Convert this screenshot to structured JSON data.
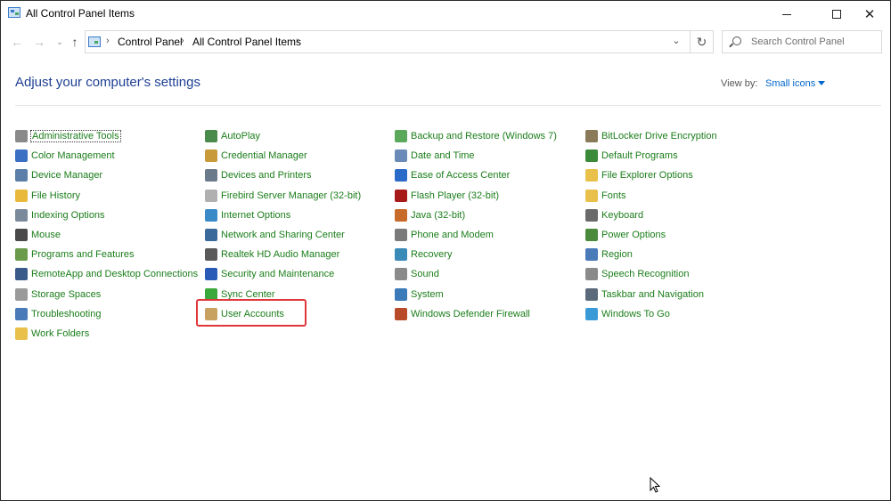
{
  "window": {
    "title": "All Control Panel Items"
  },
  "titlebar": {
    "minimize": "—",
    "close": "✕"
  },
  "nav": {
    "back": "←",
    "forward": "→",
    "recent": "⌄",
    "up": "↑",
    "separator": "›",
    "breadcrumbs": [
      "Control Panel",
      "All Control Panel Items"
    ],
    "dropdown": "⌄",
    "refresh": "↻"
  },
  "search": {
    "placeholder": "Search Control Panel"
  },
  "header": {
    "title": "Adjust your computer's settings",
    "view_by_label": "View by:",
    "view_by_value": "Small icons"
  },
  "colors": {
    "link": "#1a7d1a",
    "title": "#1e3f93",
    "accent": "#0066cc",
    "highlight": "#e0363a"
  },
  "columns": [
    [
      {
        "label": "Administrative Tools",
        "icon": "admin-tools-icon",
        "color": "#8a8a8a",
        "focused": true
      },
      {
        "label": "Color Management",
        "icon": "color-management-icon",
        "color": "#3a6fc4"
      },
      {
        "label": "Device Manager",
        "icon": "device-manager-icon",
        "color": "#5b7fa8"
      },
      {
        "label": "File History",
        "icon": "file-history-icon",
        "color": "#e8b93a"
      },
      {
        "label": "Indexing Options",
        "icon": "indexing-options-icon",
        "color": "#7a8a9a"
      },
      {
        "label": "Mouse",
        "icon": "mouse-icon",
        "color": "#4a4a4a"
      },
      {
        "label": "Programs and Features",
        "icon": "programs-features-icon",
        "color": "#6a9a4a"
      },
      {
        "label": "RemoteApp and Desktop Connections",
        "icon": "remoteapp-icon",
        "color": "#3a5a8a"
      },
      {
        "label": "Storage Spaces",
        "icon": "storage-spaces-icon",
        "color": "#9a9a9a"
      },
      {
        "label": "Troubleshooting",
        "icon": "troubleshooting-icon",
        "color": "#4a7ab8"
      },
      {
        "label": "Work Folders",
        "icon": "work-folders-icon",
        "color": "#e8c04a"
      }
    ],
    [
      {
        "label": "AutoPlay",
        "icon": "autoplay-icon",
        "color": "#4a8a4a"
      },
      {
        "label": "Credential Manager",
        "icon": "credential-manager-icon",
        "color": "#c89a3a"
      },
      {
        "label": "Devices and Printers",
        "icon": "devices-printers-icon",
        "color": "#6a7a8a"
      },
      {
        "label": "Firebird Server Manager (32-bit)",
        "icon": "firebird-icon",
        "color": "#b0b0b0"
      },
      {
        "label": "Internet Options",
        "icon": "internet-options-icon",
        "color": "#3a8ac8"
      },
      {
        "label": "Network and Sharing Center",
        "icon": "network-sharing-icon",
        "color": "#3a6a9a"
      },
      {
        "label": "Realtek HD Audio Manager",
        "icon": "realtek-audio-icon",
        "color": "#5a5a5a"
      },
      {
        "label": "Security and Maintenance",
        "icon": "security-maintenance-icon",
        "color": "#2a5ab8"
      },
      {
        "label": "Sync Center",
        "icon": "sync-center-icon",
        "color": "#3aa83a"
      },
      {
        "label": "User Accounts",
        "icon": "user-accounts-icon",
        "color": "#c8a060"
      }
    ],
    [
      {
        "label": "Backup and Restore (Windows 7)",
        "icon": "backup-restore-icon",
        "color": "#5aa85a"
      },
      {
        "label": "Date and Time",
        "icon": "date-time-icon",
        "color": "#6a8ab8"
      },
      {
        "label": "Ease of Access Center",
        "icon": "ease-of-access-icon",
        "color": "#2a6ac8"
      },
      {
        "label": "Flash Player (32-bit)",
        "icon": "flash-player-icon",
        "color": "#a81a1a"
      },
      {
        "label": "Java (32-bit)",
        "icon": "java-icon",
        "color": "#c86a2a"
      },
      {
        "label": "Phone and Modem",
        "icon": "phone-modem-icon",
        "color": "#7a7a7a"
      },
      {
        "label": "Recovery",
        "icon": "recovery-icon",
        "color": "#3a8ab8"
      },
      {
        "label": "Sound",
        "icon": "sound-icon",
        "color": "#8a8a8a"
      },
      {
        "label": "System",
        "icon": "system-icon",
        "color": "#3a7ab8"
      },
      {
        "label": "Windows Defender Firewall",
        "icon": "firewall-icon",
        "color": "#b84a2a"
      }
    ],
    [
      {
        "label": "BitLocker Drive Encryption",
        "icon": "bitlocker-icon",
        "color": "#8a7a5a"
      },
      {
        "label": "Default Programs",
        "icon": "default-programs-icon",
        "color": "#3a8a3a"
      },
      {
        "label": "File Explorer Options",
        "icon": "file-explorer-options-icon",
        "color": "#e8c04a"
      },
      {
        "label": "Fonts",
        "icon": "fonts-icon",
        "color": "#e8c04a"
      },
      {
        "label": "Keyboard",
        "icon": "keyboard-icon",
        "color": "#6a6a6a"
      },
      {
        "label": "Power Options",
        "icon": "power-options-icon",
        "color": "#4a8a3a"
      },
      {
        "label": "Region",
        "icon": "region-icon",
        "color": "#4a7ab8"
      },
      {
        "label": "Speech Recognition",
        "icon": "speech-recognition-icon",
        "color": "#8a8a8a"
      },
      {
        "label": "Taskbar and Navigation",
        "icon": "taskbar-navigation-icon",
        "color": "#5a6a7a"
      },
      {
        "label": "Windows To Go",
        "icon": "windows-to-go-icon",
        "color": "#3a9ad8"
      }
    ]
  ]
}
